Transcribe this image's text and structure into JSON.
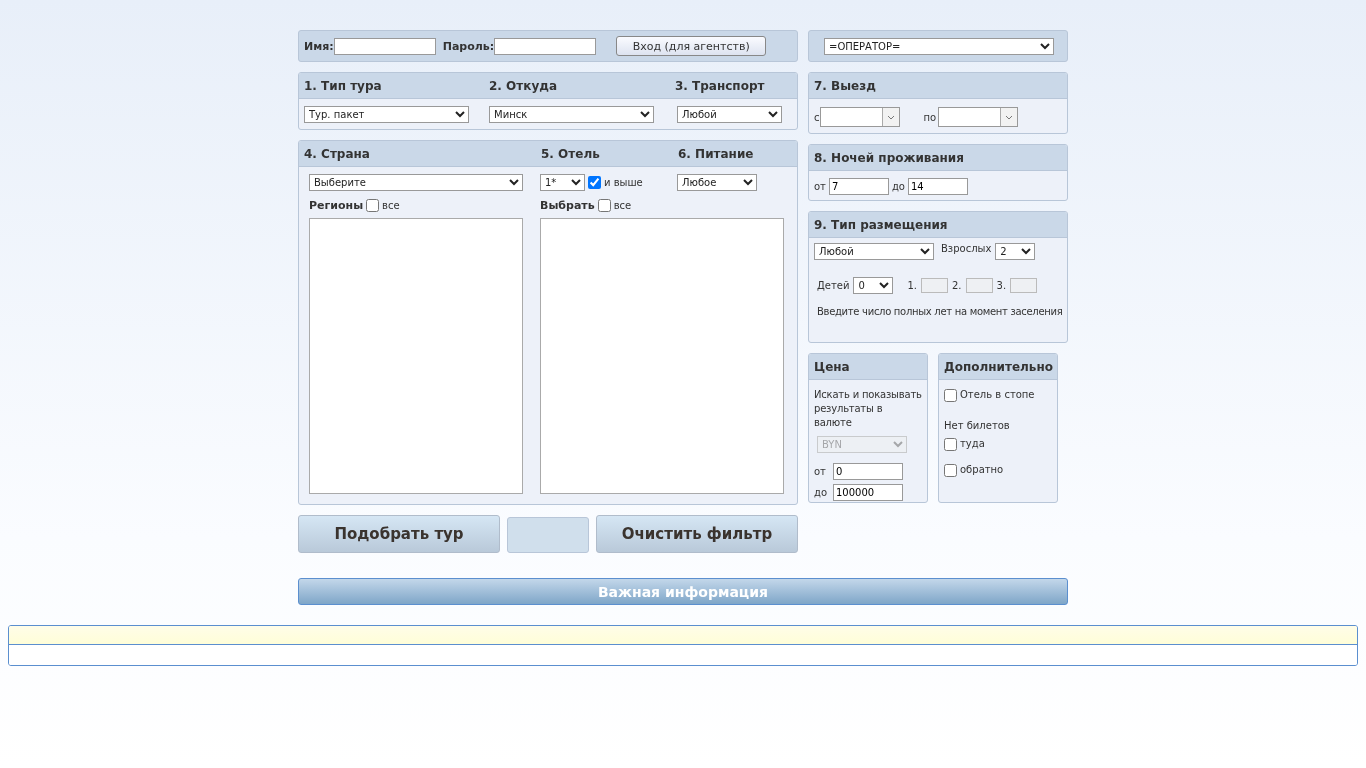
{
  "login": {
    "name_label": "Имя:",
    "password_label": "Пароль:",
    "button": "Вход (для агентств)"
  },
  "operator": {
    "value": "=ОПЕРАТОР="
  },
  "tour": {
    "columns": [
      {
        "title": "1. Тип тура",
        "value": "Тур. пакет"
      },
      {
        "title": "2. Откуда",
        "value": "Минск"
      },
      {
        "title": "3. Транспорт",
        "value": "Любой"
      }
    ]
  },
  "country": {
    "title": "4. Страна",
    "value": "Выберите",
    "regions_label": "Регионы",
    "all_text": "все",
    "all_checked": false
  },
  "hotel": {
    "title": "5. Отель",
    "category": "1*",
    "above_label": "и выше",
    "above_checked": true,
    "pick_label": "Выбрать",
    "all_text": "все",
    "all_checked": false
  },
  "meal": {
    "title": "6. Питание",
    "value": "Любое"
  },
  "departure": {
    "title": "7. Выезд",
    "from_label": "с",
    "to_label": "по"
  },
  "nights": {
    "title": "8. Ночей проживания",
    "from_label": "от",
    "from_value": "7",
    "to_label": "до",
    "to_value": "14"
  },
  "accommodation": {
    "title": "9. Тип размещения",
    "type_value": "Любой",
    "adults_label": "Взрослых",
    "adults_value": "2",
    "children_label": "Детей",
    "children_value": "0",
    "ages": [
      {
        "label": "1.",
        "disabled": true
      },
      {
        "label": "2.",
        "disabled": true
      },
      {
        "label": "3.",
        "disabled": true
      }
    ],
    "hint": "Введите число полных лет на момент заселения"
  },
  "price": {
    "title": "Цена",
    "note": "Искать и показывать результаты в валюте",
    "currency": "BYN",
    "currency_disabled": true,
    "from_label": "от",
    "from_value": "0",
    "to_label": "до",
    "to_value": "100000"
  },
  "extra": {
    "title": "Дополнительно",
    "stop_label": "Отель в стопе",
    "stop_checked": false,
    "no_tickets_label": "Нет билетов",
    "tickets": [
      {
        "label": "туда",
        "checked": false
      },
      {
        "label": "обратно",
        "checked": false
      }
    ]
  },
  "actions": {
    "search_button": "Подобрать тур",
    "clear_button": "Очистить фильтр"
  },
  "info_bar": {
    "title": "Важная информация"
  }
}
